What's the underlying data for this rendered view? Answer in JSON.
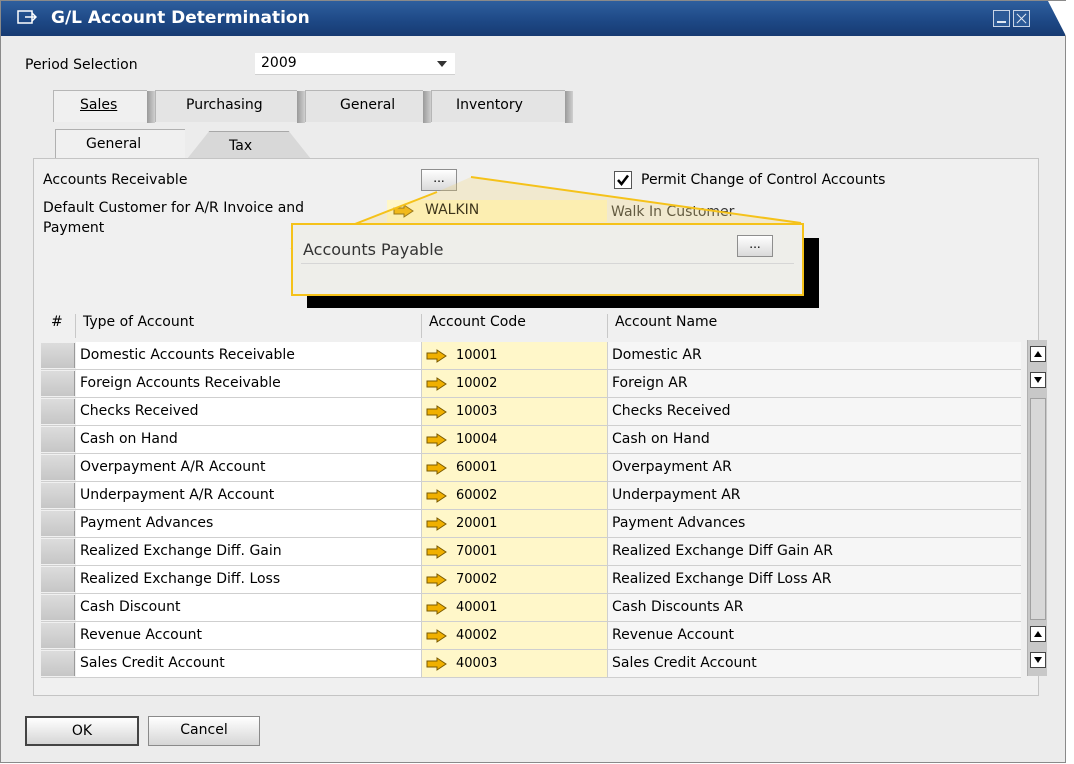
{
  "window": {
    "title": "G/L Account Determination"
  },
  "period": {
    "label": "Period Selection",
    "value": "2009"
  },
  "tabs": [
    {
      "label": "Sales"
    },
    {
      "label": "Purchasing"
    },
    {
      "label": "General"
    },
    {
      "label": "Inventory"
    }
  ],
  "subtabs": [
    {
      "label": "General"
    },
    {
      "label": "Tax"
    }
  ],
  "fields": {
    "accounts_receivable_label": "Accounts Receivable",
    "dots_label": "...",
    "permit_change_label": "Permit Change of Control Accounts",
    "permit_change_checked": true,
    "default_customer_label_line1": "Default Customer for A/R Invoice and",
    "default_customer_label_line2": "Payment",
    "default_customer_code": "WALKIN",
    "default_customer_name": "Walk In Customer"
  },
  "callout": {
    "label": "Accounts Payable",
    "button_label": "...",
    "highlight_color": "#f5c21a"
  },
  "table": {
    "headers": [
      "#",
      "Type of Account",
      "Account Code",
      "Account Name"
    ],
    "rows": [
      {
        "type": "Domestic Accounts Receivable",
        "code": "10001",
        "name": "Domestic AR"
      },
      {
        "type": "Foreign Accounts Receivable",
        "code": "10002",
        "name": "Foreign AR"
      },
      {
        "type": "Checks Received",
        "code": "10003",
        "name": "Checks Received"
      },
      {
        "type": "Cash on Hand",
        "code": "10004",
        "name": "Cash on Hand"
      },
      {
        "type": "Overpayment A/R Account",
        "code": "60001",
        "name": "Overpayment AR"
      },
      {
        "type": "Underpayment A/R Account",
        "code": "60002",
        "name": "Underpayment AR"
      },
      {
        "type": "Payment Advances",
        "code": "20001",
        "name": "Payment Advances"
      },
      {
        "type": "Realized Exchange Diff. Gain",
        "code": "70001",
        "name": "Realized Exchange Diff Gain AR"
      },
      {
        "type": "Realized Exchange Diff. Loss",
        "code": "70002",
        "name": "Realized Exchange Diff Loss AR"
      },
      {
        "type": "Cash Discount",
        "code": "40001",
        "name": "Cash Discounts AR"
      },
      {
        "type": "Revenue Account",
        "code": "40002",
        "name": "Revenue Account"
      },
      {
        "type": "Sales Credit Account",
        "code": "40003",
        "name": "Sales Credit Account"
      }
    ]
  },
  "buttons": {
    "ok": "OK",
    "cancel": "Cancel"
  },
  "colors": {
    "titlebar": "#1d4784",
    "link_arrow": "#f0b000",
    "code_field_bg": "#fff7c9"
  },
  "icons": {
    "link_arrow": "link-arrow-icon",
    "window": "window-icon",
    "checkmark": "checkmark-icon"
  }
}
